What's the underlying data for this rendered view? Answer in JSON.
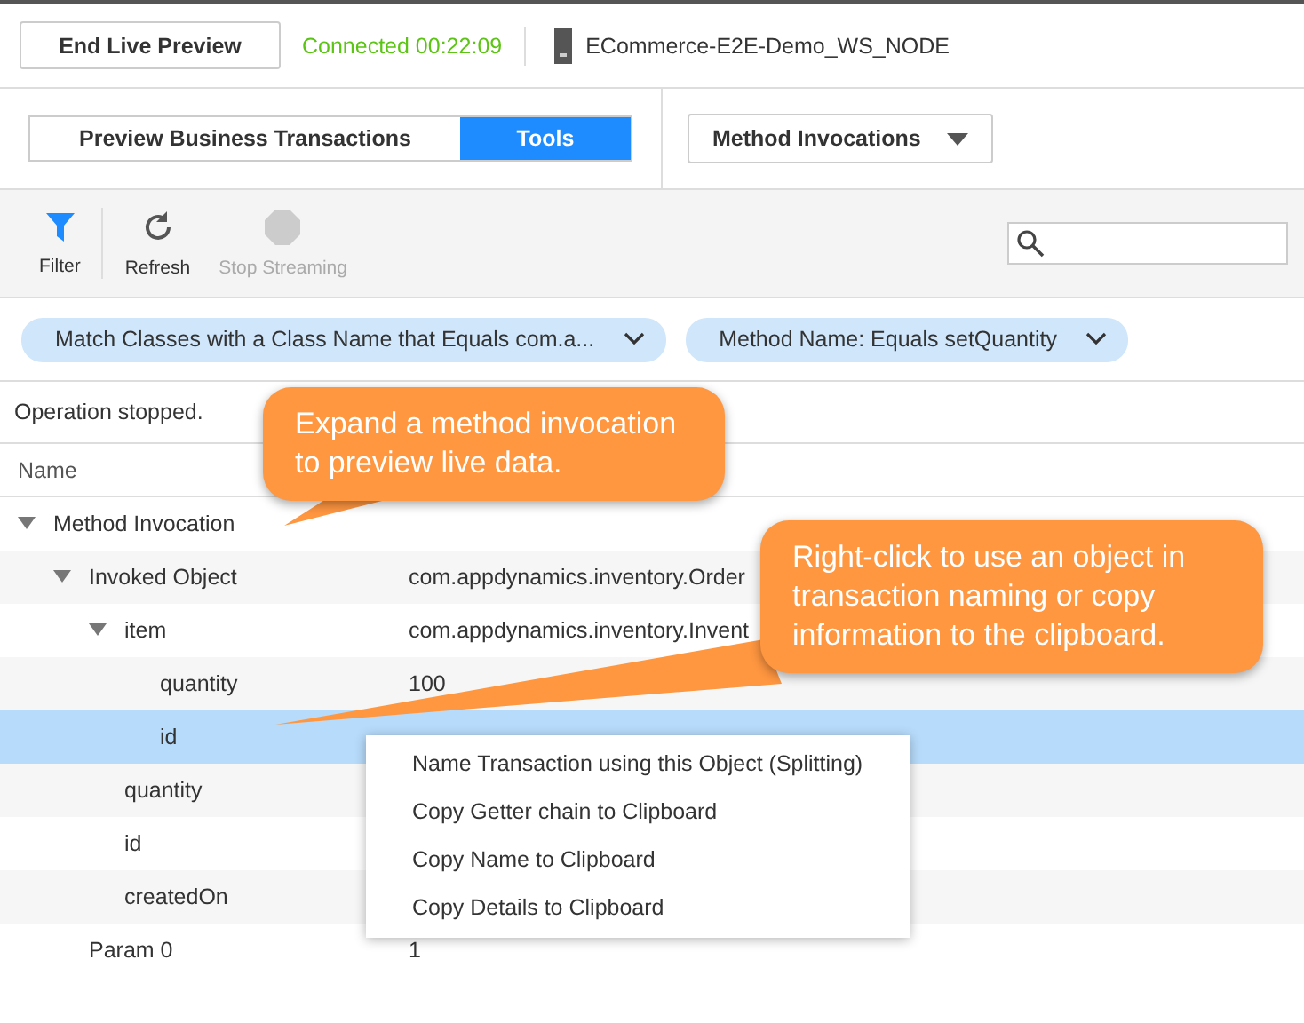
{
  "header": {
    "end_button": "End Live Preview",
    "status": "Connected 00:22:09",
    "node": "ECommerce-E2E-Demo_WS_NODE"
  },
  "tabs": [
    {
      "label": "Preview Business Transactions",
      "selected": false
    },
    {
      "label": "Tools",
      "selected": true
    }
  ],
  "view_dropdown": {
    "value": "Method Invocations"
  },
  "toolbar": [
    {
      "kind": "filter",
      "label": "Filter",
      "disabled": false
    },
    {
      "kind": "refresh",
      "label": "Refresh",
      "disabled": false
    },
    {
      "kind": "stop",
      "label": "Stop Streaming",
      "disabled": true
    }
  ],
  "filters": [
    {
      "label": "Match Classes with a Class Name that Equals com.a..."
    },
    {
      "label": "Method Name: Equals setQuantity"
    }
  ],
  "status_message": "Operation stopped.",
  "table": {
    "columns": [
      "Name"
    ],
    "rows": [
      {
        "name": "Method Invocation",
        "expanded": true,
        "selected": false,
        "children": [
          {
            "name": "Invoked Object",
            "value": "com.appdynamics.inventory.Order",
            "expanded": true,
            "selected": false,
            "children": [
              {
                "name": "item",
                "value": "com.appdynamics.inventory.Invent",
                "expanded": true,
                "selected": false,
                "children": [
                  {
                    "name": "quantity",
                    "value": "100",
                    "selected": false
                  },
                  {
                    "name": "id",
                    "selected": true
                  }
                ]
              },
              {
                "name": "quantity",
                "selected": false
              },
              {
                "name": "id",
                "selected": false
              },
              {
                "name": "createdOn",
                "selected": false
              }
            ]
          },
          {
            "name": "Param 0",
            "value": "1",
            "selected": false
          }
        ]
      }
    ]
  },
  "context_menu": [
    "Name Transaction using this Object (Splitting)",
    "Copy Getter chain to Clipboard",
    "Copy Name to Clipboard",
    "Copy Details to Clipboard"
  ],
  "callouts": [
    {
      "text": "Expand a method invocation to preview live data."
    },
    {
      "text": "Right-click to use an object in transaction naming or copy information to the clipboard."
    }
  ]
}
